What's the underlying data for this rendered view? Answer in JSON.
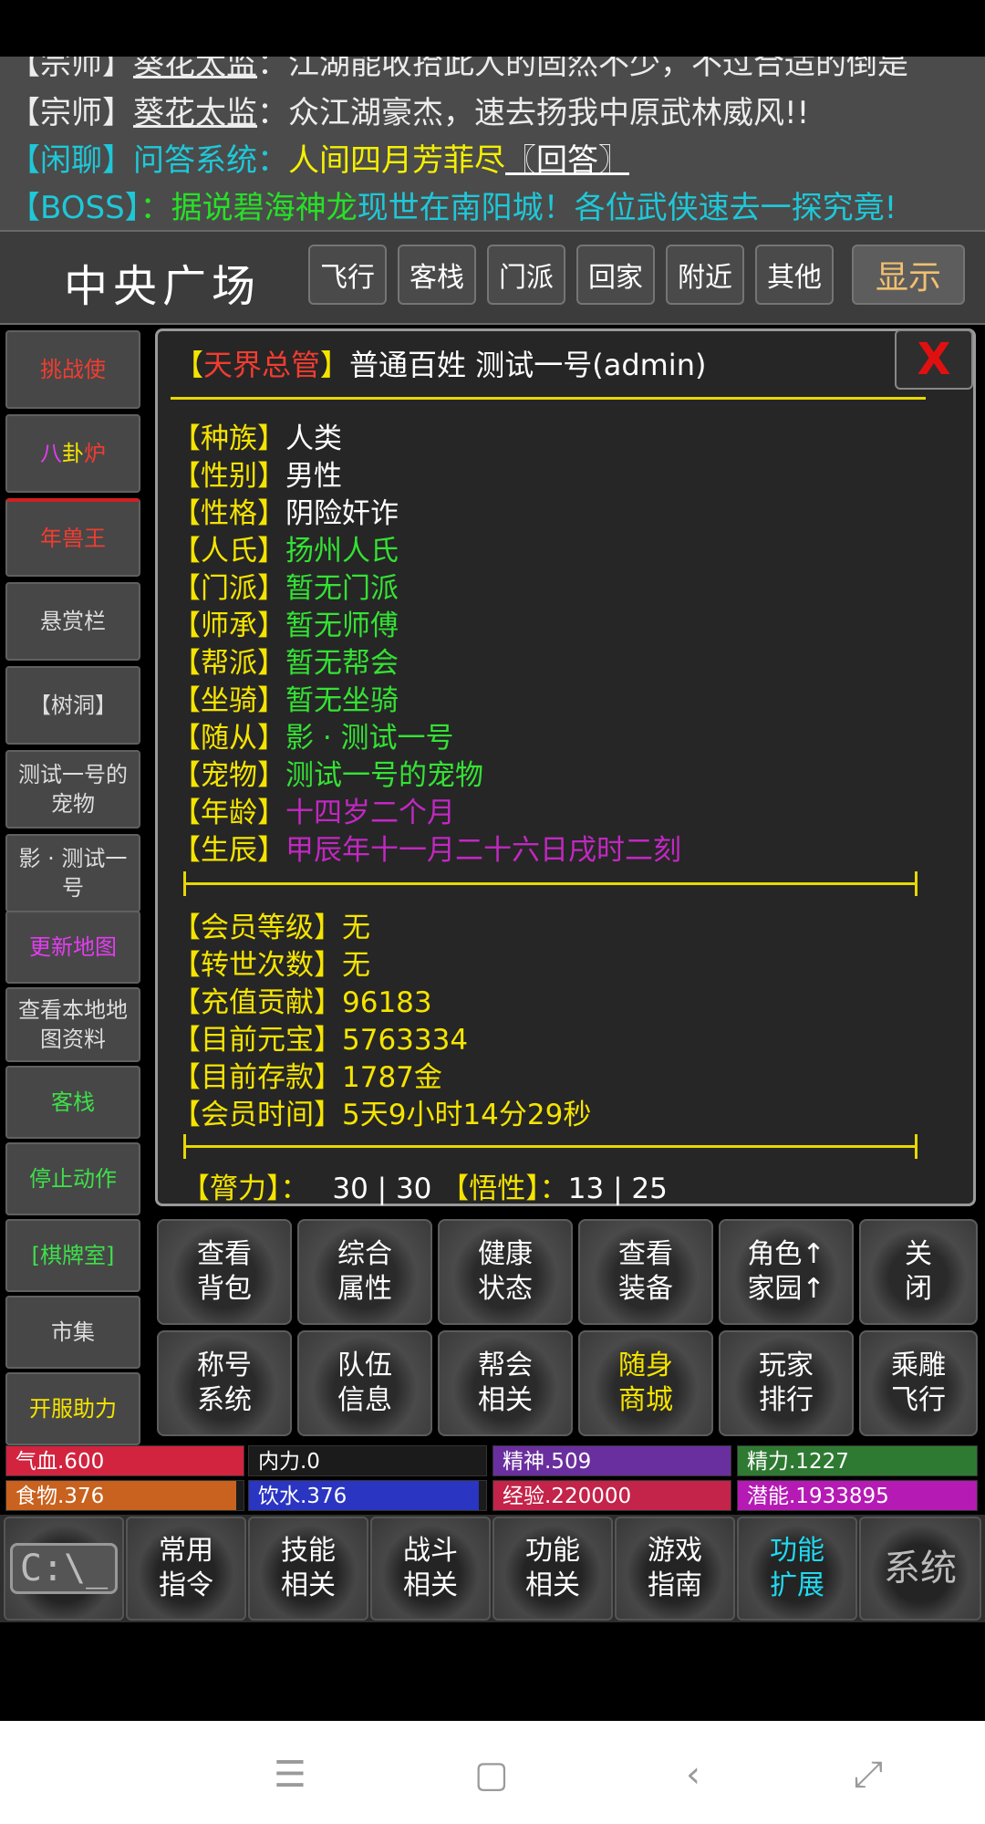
{
  "chat": {
    "line0": {
      "tag": "【宗师】",
      "name": "葵花太监",
      "text": "：江湖能收拾此人的固然不少，不过合适的倒是"
    },
    "line1": {
      "tag": "【宗师】",
      "name": "葵花太监",
      "text": "：众江湖豪杰，速去扬我中原武林威风!!"
    },
    "line2": {
      "tag": "【闲聊】问答系统：",
      "text": "人间四月芳菲尽",
      "link": "〖回答〗"
    },
    "line3": {
      "tag": "【BOSS】",
      "text_a": "：据说碧海神龙",
      "text_b": "现世在南阳城！各位武侠速去一探究竟!"
    }
  },
  "location": {
    "title": "中央广场",
    "buttons": [
      "飞行",
      "客栈",
      "门派",
      "回家",
      "附近",
      "其他"
    ],
    "show": "显示"
  },
  "sidebar": {
    "items": [
      {
        "label": "挑战使",
        "color": "#f23c30"
      },
      {
        "label_a": "八",
        "label_b": "卦",
        "label_c": "炉"
      },
      {
        "label": "年兽王"
      },
      {
        "label": "悬赏栏"
      },
      {
        "label": "【树洞】"
      },
      {
        "label": "测试一号的宠物"
      },
      {
        "label": "影 · 测试一号"
      },
      {
        "label": "更新地图"
      },
      {
        "label": "查看本地地图资料"
      },
      {
        "label": "客栈"
      },
      {
        "label": "停止动作"
      },
      {
        "label": "[棋牌室]"
      },
      {
        "label": "市集"
      },
      {
        "label": "开服助力"
      }
    ]
  },
  "panel": {
    "title_tag": "天界总管",
    "title_rest": "普通百姓 测试一号(admin)",
    "close": "X",
    "attrs": [
      {
        "k": "种族",
        "v": "人类"
      },
      {
        "k": "性别",
        "v": "男性"
      },
      {
        "k": "性格",
        "v": "阴险奸诈"
      },
      {
        "k": "人氏",
        "v": "扬州人氏"
      },
      {
        "k": "门派",
        "v": "暂无门派"
      },
      {
        "k": "师承",
        "v": "暂无师傅"
      },
      {
        "k": "帮派",
        "v": "暂无帮会"
      },
      {
        "k": "坐骑",
        "v": "暂无坐骑"
      },
      {
        "k": "随从",
        "v": "影 · 测试一号"
      },
      {
        "k": "宠物",
        "v": "测试一号的宠物"
      },
      {
        "k": "年龄",
        "v": "十四岁二个月"
      },
      {
        "k": "生辰",
        "v": "甲辰年十一月二十六日戌时二刻"
      }
    ],
    "account": [
      {
        "k": "会员等级",
        "v": "无"
      },
      {
        "k": "转世次数",
        "v": "无"
      },
      {
        "k": "充值贡献",
        "v": "96183"
      },
      {
        "k": "目前元宝",
        "v": "5763334"
      },
      {
        "k": "目前存款",
        "v": "1787金"
      },
      {
        "k": "会员时间",
        "v": "5天9小时14分29秒"
      }
    ],
    "footer": {
      "k1": "膂力",
      "v1": "30 | 30",
      "k2": "悟性",
      "v2": "13 | 25"
    }
  },
  "actions": {
    "row1": [
      {
        "l1": "查看",
        "l2": "背包"
      },
      {
        "l1": "综合",
        "l2": "属性"
      },
      {
        "l1": "健康",
        "l2": "状态"
      },
      {
        "l1": "查看",
        "l2": "装备"
      },
      {
        "l1": "角色↑",
        "l2": "家园↑"
      },
      {
        "l1": "关",
        "l2": "闭"
      }
    ],
    "row2": [
      {
        "l1": "称号",
        "l2": "系统"
      },
      {
        "l1": "队伍",
        "l2": "信息"
      },
      {
        "l1": "帮会",
        "l2": "相关"
      },
      {
        "l1": "随身",
        "l2": "商城"
      },
      {
        "l1": "玩家",
        "l2": "排行"
      },
      {
        "l1": "乘雕",
        "l2": "飞行"
      }
    ]
  },
  "stats": [
    {
      "label": "气血.600",
      "color": "#d2233f",
      "level": 1.0
    },
    {
      "label": "内力.0",
      "color": "#1b1b1b",
      "level": 0.0
    },
    {
      "label": "精神.509",
      "color": "#6a2f9e",
      "level": 1.0
    },
    {
      "label": "精力.1227",
      "color": "#2f7a32",
      "level": 1.0
    },
    {
      "label": "食物.376",
      "color": "#c8621e",
      "level": 0.97
    },
    {
      "label": "饮水.376",
      "color": "#2a35c2",
      "level": 0.97
    },
    {
      "label": "经验.220000",
      "color": "#c4234a",
      "level": 1.0
    },
    {
      "label": "潜能.1933895",
      "color": "#b51ab5",
      "level": 1.0
    }
  ],
  "bottom_nav": [
    {
      "l1": "常用",
      "l2": "指令"
    },
    {
      "l1": "技能",
      "l2": "相关"
    },
    {
      "l1": "战斗",
      "l2": "相关"
    },
    {
      "l1": "功能",
      "l2": "相关"
    },
    {
      "l1": "游戏",
      "l2": "指南"
    },
    {
      "l1": "功能",
      "l2": "扩展"
    }
  ],
  "bottom_icons": {
    "cmd": "C:\\_",
    "system": "系统"
  }
}
